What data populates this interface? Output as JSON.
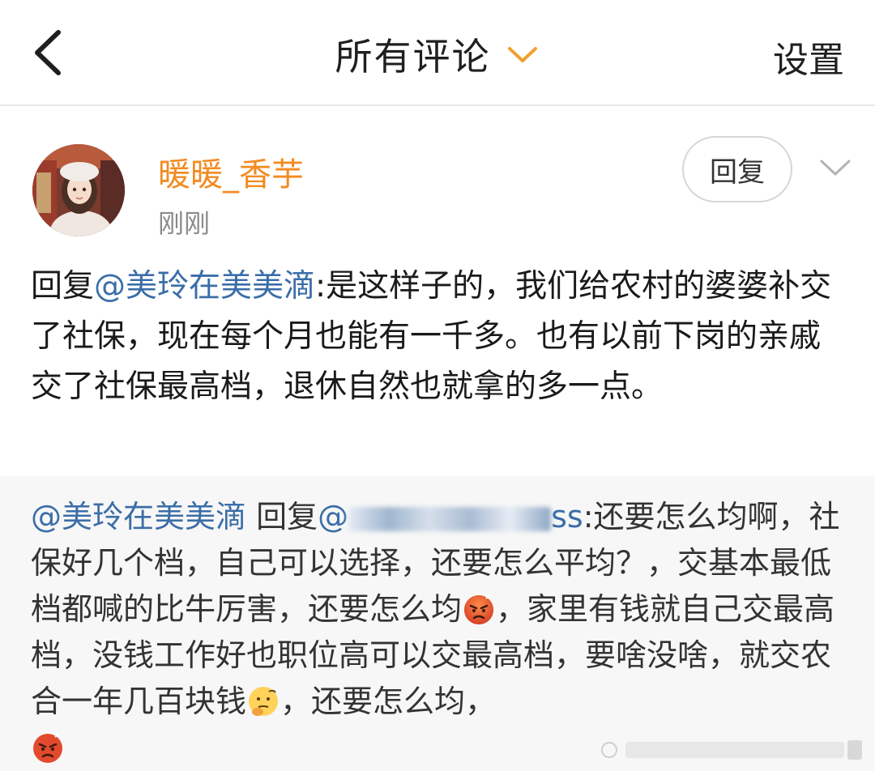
{
  "header": {
    "title": "所有评论",
    "settings_label": "设置"
  },
  "comment": {
    "username": "暖暖_香芋",
    "timestamp": "刚刚",
    "reply_button": "回复",
    "reply_prefix": "回复",
    "mention": "@美玲在美美滴",
    "text": ":是这样子的，我们给农村的婆婆补交了社保，现在每个月也能有一千多。也有以前下岗的亲戚交了社保最高档，退休自然也就拿的多一点。"
  },
  "quoted": {
    "author_mention": "@美玲在美美滴",
    "reply_word": "回复",
    "target_mention_visible_start": "@",
    "target_mention_visible_end": "ss",
    "text_part1": ":还要怎么均啊，社保好几个档，自己可以选择，还要怎么平均？，交基本最低档都喊的比牛厉害，还要怎么均",
    "text_part2": "，家里有钱就自己交最高档，没钱工作好也职位高可以交最高档，要啥没啥，就交农合一年几百块钱",
    "text_part3": "，还要怎么均，",
    "emoji_angry": "angry-face-icon",
    "emoji_thinking": "thinking-face-icon"
  },
  "colors": {
    "username": "#f28b22",
    "mention": "#3b6ea8",
    "accent_chevron": "#f0a030",
    "quoted_bg": "#f7f7f7"
  }
}
